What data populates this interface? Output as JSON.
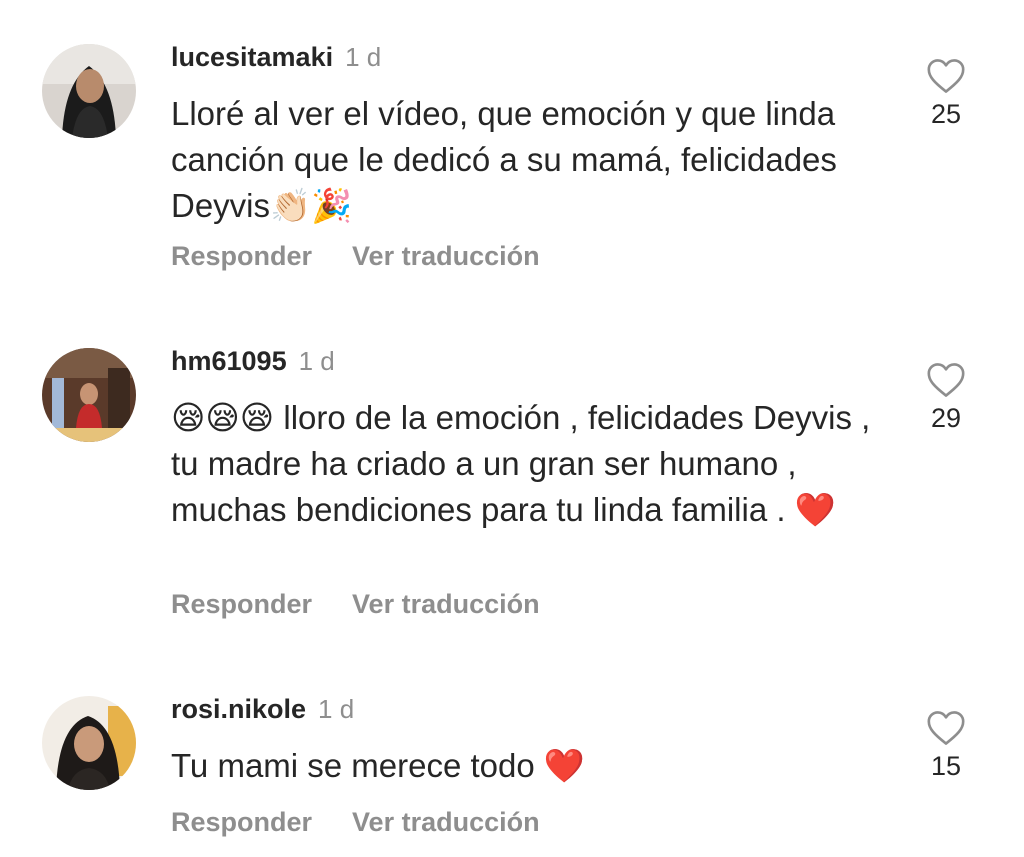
{
  "comments": [
    {
      "username": "lucesitamaki",
      "time": "1 d",
      "text": "Lloré al ver el vídeo, que emoción y que linda canción que le dedicó a su mamá, felicidades Deyvis👏🏻🎉",
      "likes": "25",
      "reply_label": "Responder",
      "translate_label": "Ver traducción",
      "avatar_icon": "avatar-photo",
      "like_icon": "heart-outline-icon"
    },
    {
      "username": "hm61095",
      "time": "1 d",
      "text": "😪😪😪 lloro de la emoción , felicidades Deyvis , tu madre ha criado a un gran ser humano , muchas bendiciones para tu linda familia . ❤️",
      "likes": "29",
      "reply_label": "Responder",
      "translate_label": "Ver traducción",
      "avatar_icon": "avatar-photo",
      "like_icon": "heart-outline-icon"
    },
    {
      "username": "rosi.nikole",
      "time": "1 d",
      "text": "Tu mami se merece todo ❤️",
      "likes": "15",
      "reply_label": "Responder",
      "translate_label": "Ver traducción",
      "avatar_icon": "avatar-photo",
      "like_icon": "heart-outline-icon"
    }
  ],
  "colors": {
    "text": "#262626",
    "secondary": "#8e8e8e",
    "background": "#ffffff"
  }
}
